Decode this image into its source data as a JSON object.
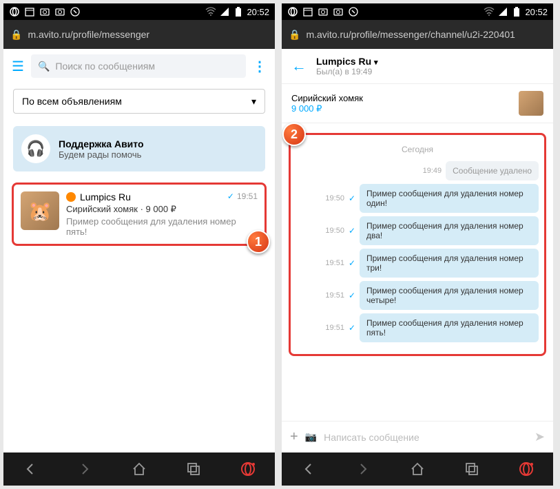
{
  "status": {
    "time": "20:52"
  },
  "s1": {
    "url": "m.avito.ru/profile/messenger",
    "search_placeholder": "Поиск по сообщениям",
    "filter": "По всем объявлениям",
    "support": {
      "title": "Поддержка Авито",
      "sub": "Будем рады помочь"
    },
    "chat": {
      "name": "Lumpics Ru",
      "subject": "Сирийский хомяк · 9 000 ₽",
      "preview": "Пример сообщения для удаления номер пять!",
      "time": "19:51"
    },
    "badge": "1"
  },
  "s2": {
    "url": "m.avito.ru/profile/messenger/channel/u2i-220401",
    "name": "Lumpics Ru",
    "seen": "Был(а) в 19:49",
    "listing": {
      "title": "Сирийский хомяк",
      "price": "9 000 ₽"
    },
    "day": "Сегодня",
    "badge": "2",
    "messages": [
      {
        "time": "19:49",
        "text": "Сообщение удалено",
        "deleted": true,
        "check": false
      },
      {
        "time": "19:50",
        "text": "Пример сообщения для удаления номер один!",
        "check": true
      },
      {
        "time": "19:50",
        "text": "Пример сообщения для удаления номер два!",
        "check": true
      },
      {
        "time": "19:51",
        "text": "Пример сообщения для удаления номер три!",
        "check": true
      },
      {
        "time": "19:51",
        "text": "Пример сообщения для удаления номер четыре!",
        "check": true
      },
      {
        "time": "19:51",
        "text": "Пример сообщения для удаления номер пять!",
        "check": true
      }
    ],
    "compose_placeholder": "Написать сообщение"
  }
}
